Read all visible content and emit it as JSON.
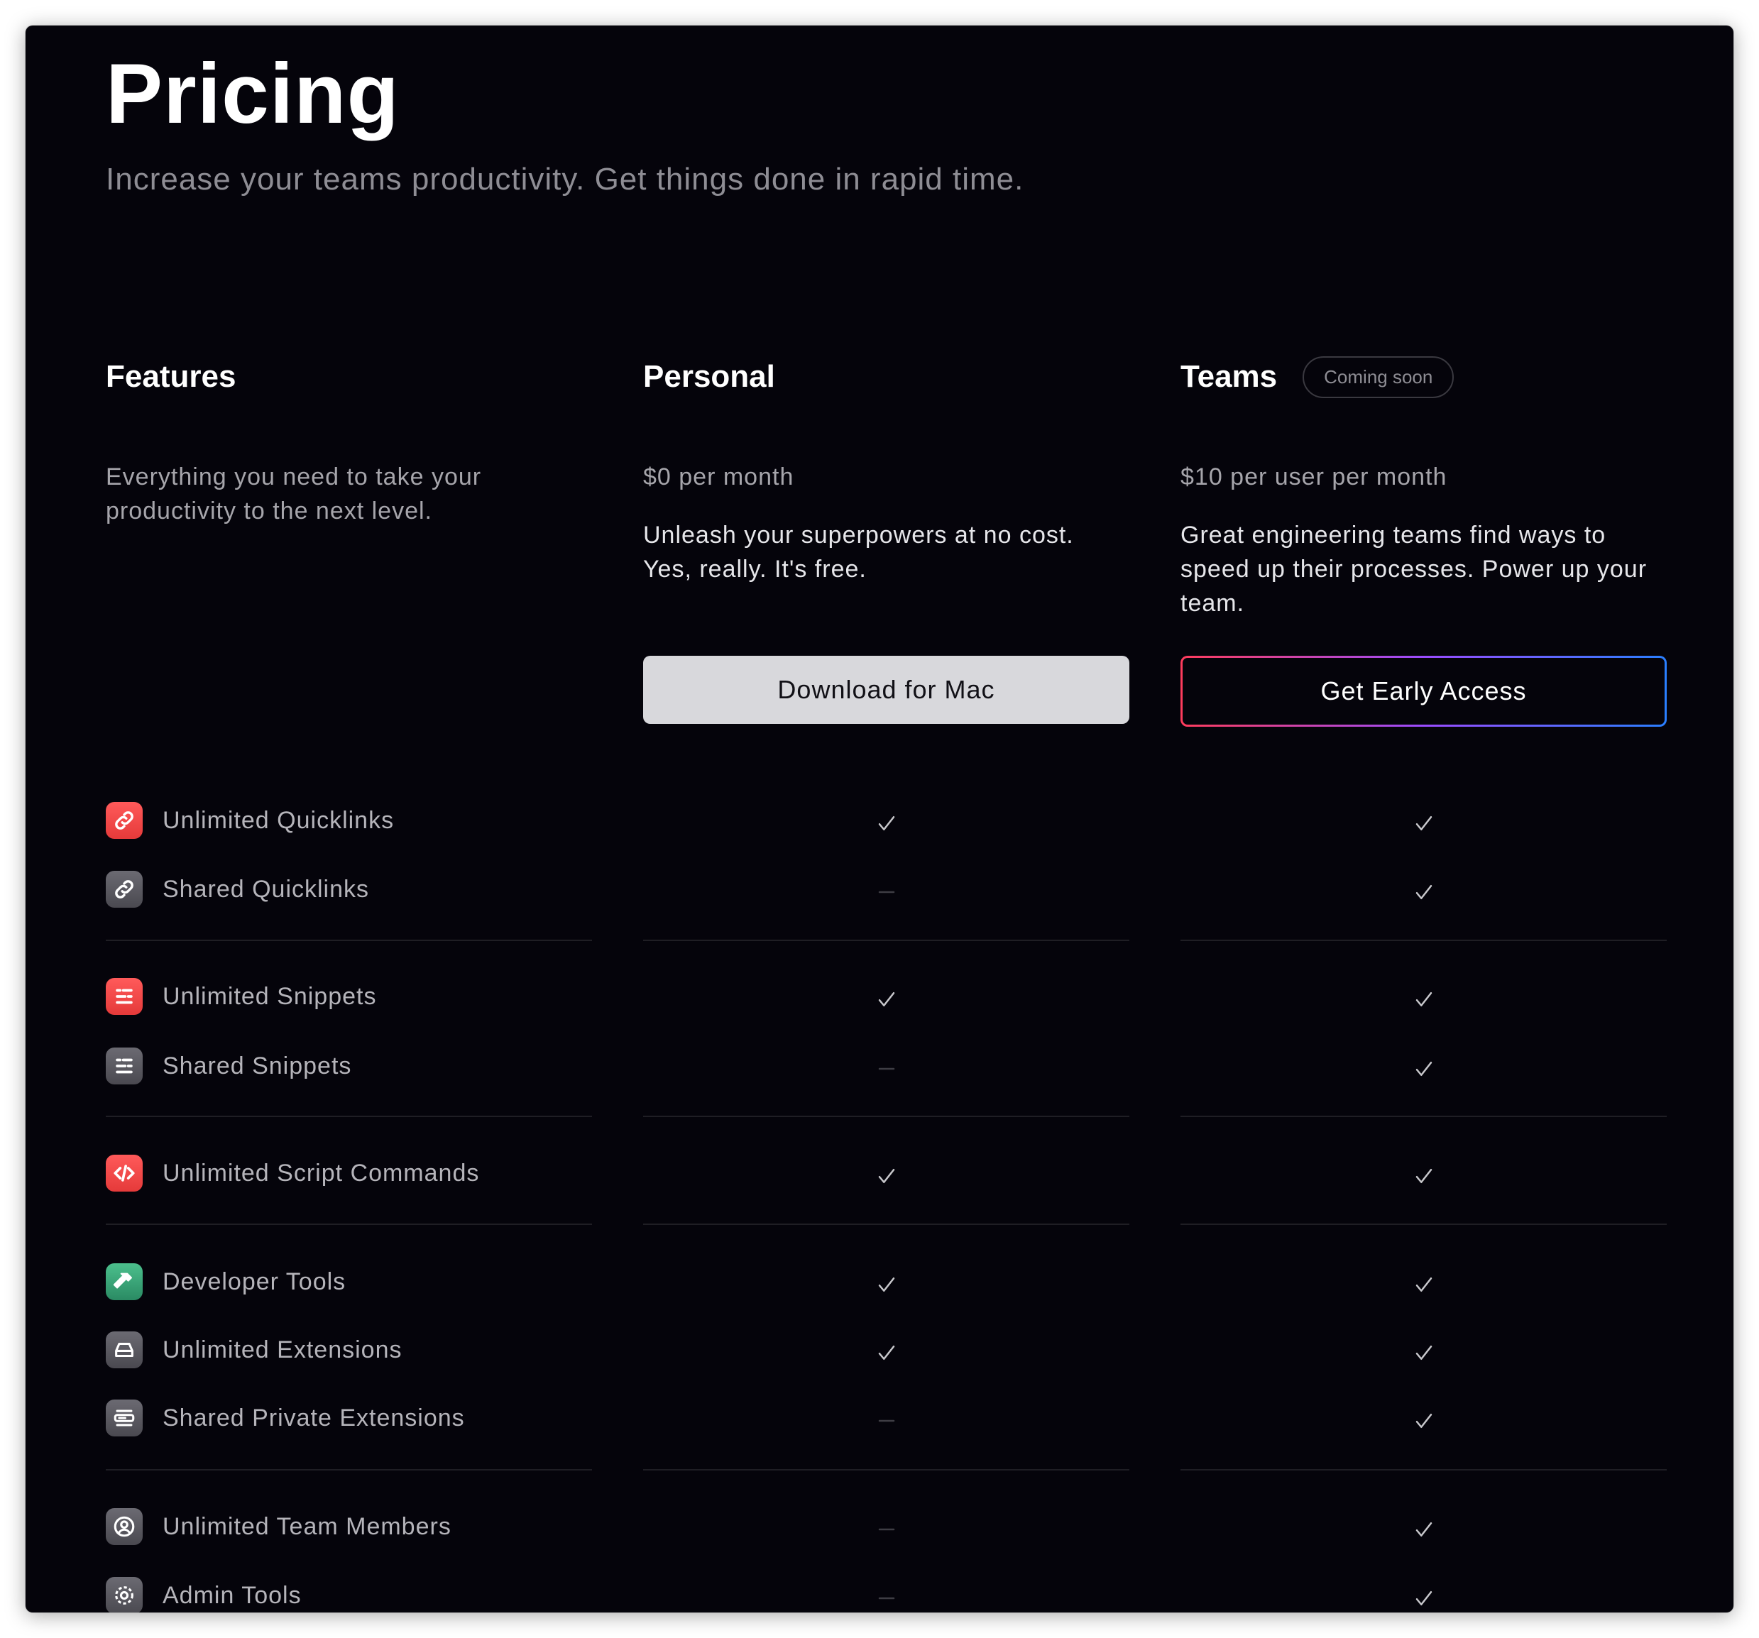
{
  "page": {
    "title": "Pricing",
    "subtitle": "Increase your teams productivity. Get things done in rapid time."
  },
  "columns": {
    "features": {
      "title": "Features",
      "description": "Everything you need to take your productivity to the next level."
    },
    "personal": {
      "title": "Personal",
      "price": "$0 per month",
      "description": "Unleash your superpowers at no cost. Yes, really. It's free.",
      "button_label": "Download for Mac"
    },
    "teams": {
      "title": "Teams",
      "badge": "Coming soon",
      "price": "$10 per user per month",
      "description": "Great engineering teams find ways to speed up their processes. Power up your team.",
      "button_label": "Get Early Access"
    }
  },
  "features": [
    {
      "label": "Unlimited Quicklinks",
      "icon": "link-icon",
      "icon_color": "#e5484d",
      "personal": true,
      "teams": true
    },
    {
      "label": "Shared Quicklinks",
      "icon": "link-icon",
      "icon_color": "#5b5a61",
      "personal": false,
      "teams": true
    },
    {
      "label": "Unlimited Snippets",
      "icon": "snippet-icon",
      "icon_color": "#e5484d",
      "personal": true,
      "teams": true
    },
    {
      "label": "Shared Snippets",
      "icon": "snippet-icon",
      "icon_color": "#5b5a61",
      "personal": false,
      "teams": true
    },
    {
      "label": "Unlimited Script Commands",
      "icon": "code-icon",
      "icon_color": "#e5484d",
      "personal": true,
      "teams": true
    },
    {
      "label": "Developer Tools",
      "icon": "hammer-icon",
      "icon_color": "#35a374",
      "personal": true,
      "teams": true
    },
    {
      "label": "Unlimited Extensions",
      "icon": "extension-icon",
      "icon_color": "#5b5a61",
      "personal": true,
      "teams": true
    },
    {
      "label": "Shared Private Extensions",
      "icon": "private-extension-icon",
      "icon_color": "#5b5a61",
      "personal": false,
      "teams": true
    },
    {
      "label": "Unlimited Team Members",
      "icon": "person-icon",
      "icon_color": "#5b5a61",
      "personal": false,
      "teams": true
    },
    {
      "label": "Admin Tools",
      "icon": "gear-icon",
      "icon_color": "#5b5a61",
      "personal": false,
      "teams": true
    }
  ],
  "colors": {
    "background": "#05040b",
    "text_primary": "#ffffff",
    "text_secondary": "#8e8d94",
    "check": "#c8c8cc",
    "dash": "#3e3d44",
    "accent_gradient": [
      "#ff3c5c",
      "#9a4cff",
      "#2a7fff"
    ]
  }
}
